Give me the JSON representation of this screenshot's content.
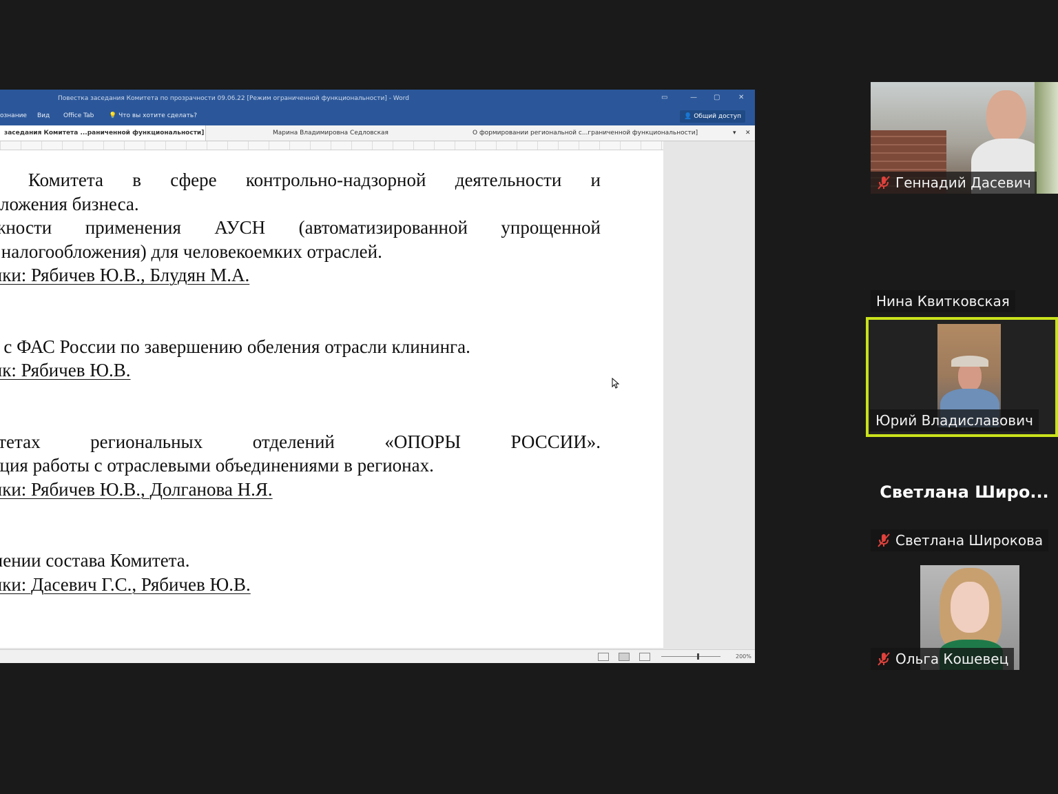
{
  "word": {
    "title": "Повестка заседания Комитета по прозрачности 09.06.22 [Режим ограниченной функциональности] - Word",
    "ribbon_tabs": [
      "ознание",
      "Вид",
      "Office Tab"
    ],
    "tell_me": "Что вы хотите сделать?",
    "share_label": "Общий доступ",
    "doc_tabs": [
      "заседания Комитета ...раниченной функциональности] *",
      "Марина Владимировна Седловская",
      "О формировании региональной с...граниченной функциональности]"
    ],
    "zoom": "200%"
  },
  "document": {
    "item1": [
      "аботе Комитета в сфере контрольно-надзорной деятельности и",
      "огообложения бизнеса."
    ],
    "item2": [
      "озможности применения АУСН (автоматизированной упрощенной",
      "темы налогообложения) для человекоемких отраслей."
    ],
    "item2_speakers": "ладчики: Рябичев Ю.В., Блудян М.А.",
    "item3": "аботе с ФАС России по завершению обеления отрасли клининга.",
    "item3_speakers": "ладчик: Рябичев Ю.В.",
    "item4": [
      "Комитетах региональных отделений «ОПОРЫ РОССИИ».",
      "анизация работы с отраслевыми объединениями в регионах."
    ],
    "item4_speakers": "ладчики: Рябичев Ю.В., Долганова Н.Я.",
    "item5": "изменении состава Комитета.",
    "item5_speakers": "ладчики: Дасевич Г.С., Рябичев Ю.В."
  },
  "participants": [
    {
      "name": "Геннадий Дасевич",
      "muted": true,
      "video": true
    },
    {
      "name": "Нина Квитковская",
      "muted": false,
      "video": false
    },
    {
      "name": "Юрий Владиславович",
      "muted": false,
      "video": true,
      "active": true
    },
    {
      "name": "Светлана Широкова",
      "display_name": "Светлана Широ...",
      "muted": true,
      "video": false
    },
    {
      "name": "Ольга Кошевец",
      "muted": true,
      "video": true
    }
  ],
  "colors": {
    "word_blue": "#2b579a",
    "active_speaker": "#c9e21b",
    "mute_red": "#e0413b"
  }
}
